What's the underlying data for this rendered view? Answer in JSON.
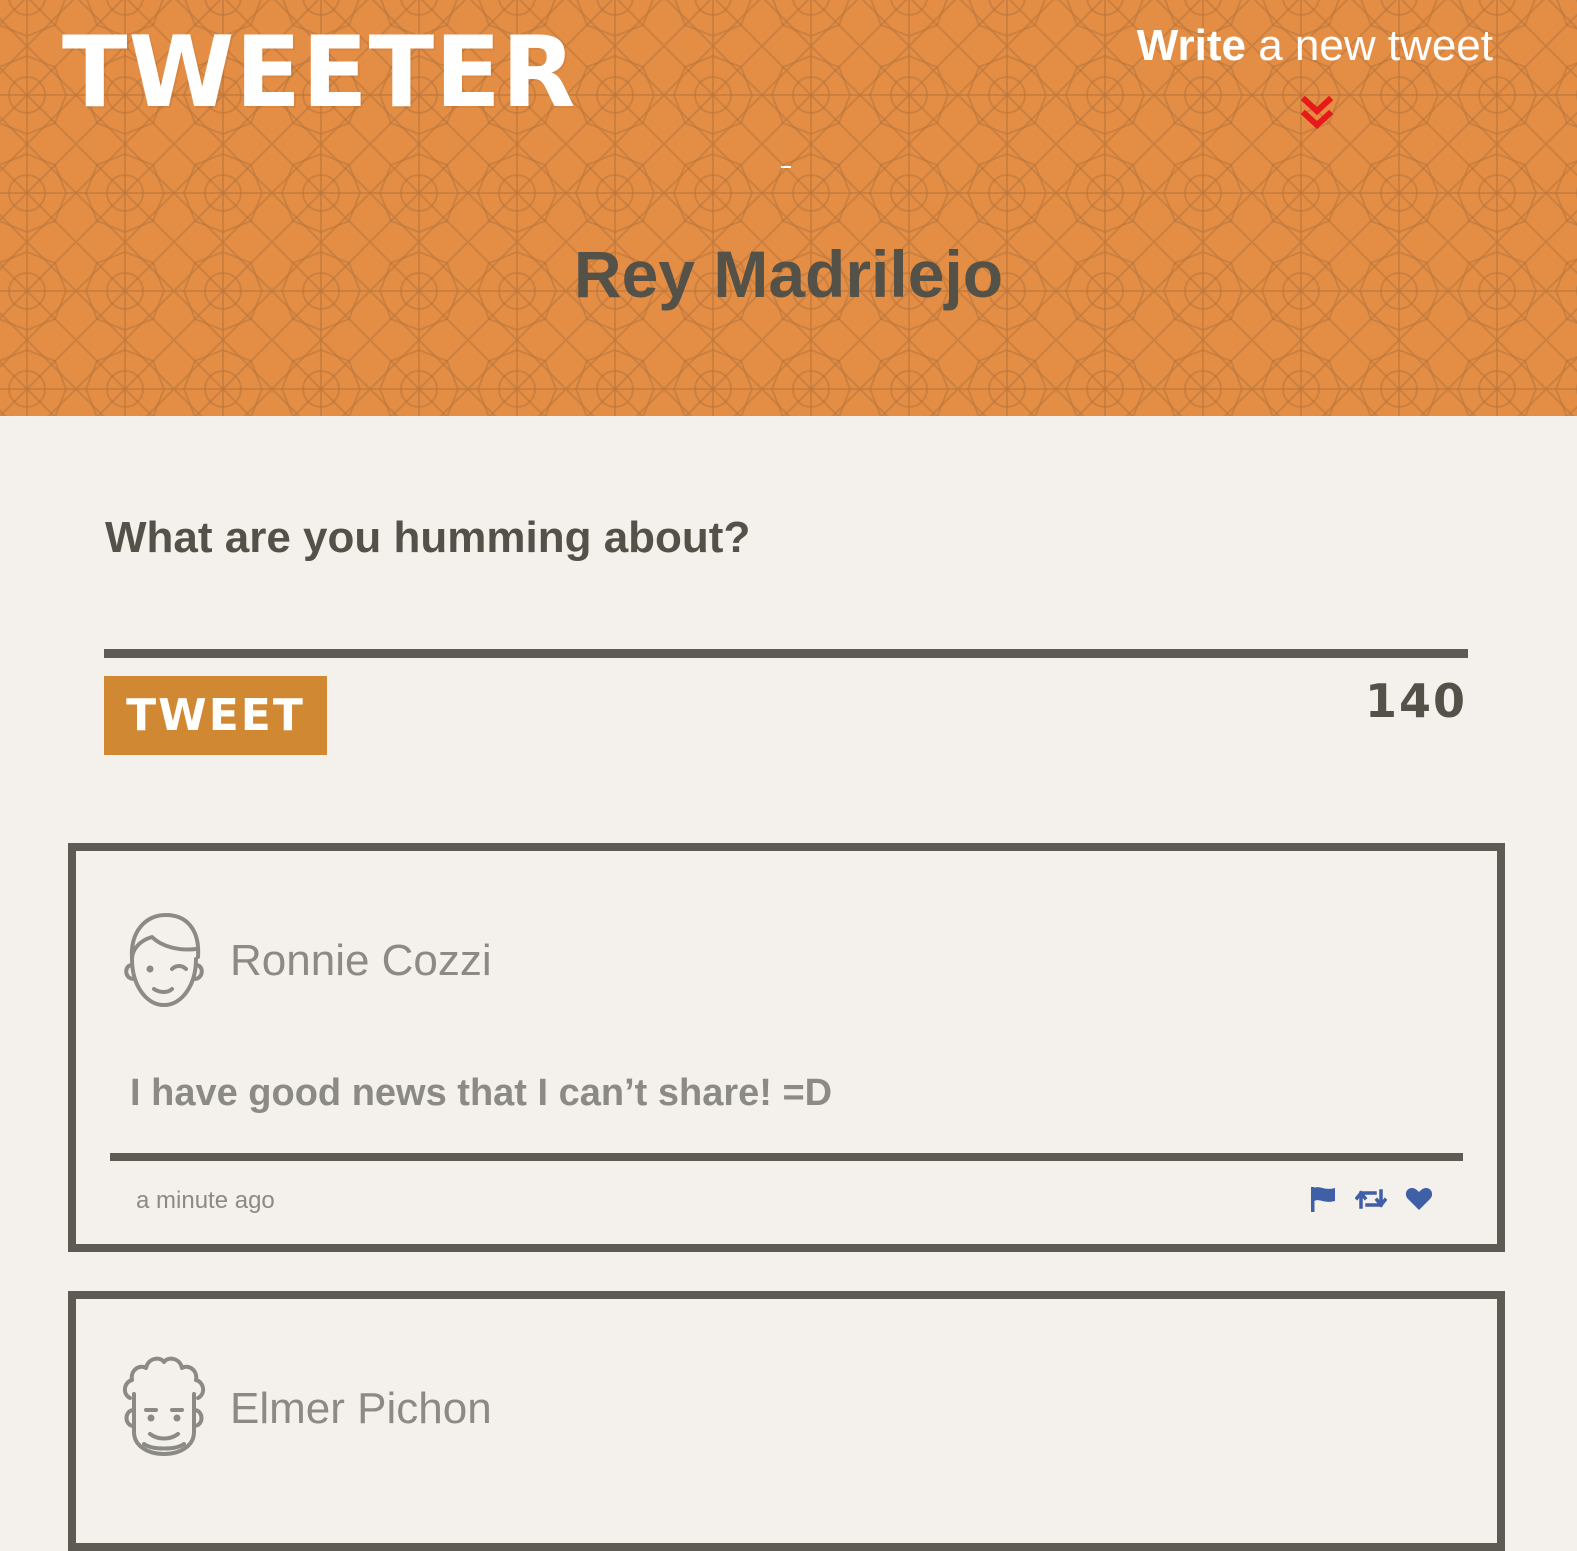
{
  "header": {
    "logo": "TWEETER",
    "compose_link": {
      "strong": "Write",
      "rest": " a new tweet"
    },
    "profile_name": "Rey Madrilejo"
  },
  "compose": {
    "prompt": "What are you humming about?",
    "input_value": "",
    "button_label": "TWEET",
    "char_count": "140"
  },
  "tweets": [
    {
      "author": "Ronnie Cozzi",
      "text": "I have good news that I can’t share! =D",
      "time": "a minute ago"
    },
    {
      "author": "Elmer Pichon"
    }
  ],
  "icons": {
    "chevron": "double-chevron-down-icon",
    "flag": "flag-icon",
    "retweet": "retweet-icon",
    "like": "heart-icon"
  },
  "colors": {
    "header_bg": "#e48e45",
    "page_bg": "#f4f1ec",
    "button_bg": "#d08832",
    "text_dark": "#545149",
    "text_muted": "#8c8a85",
    "border": "#5e5b54",
    "accent_red": "#e8191b",
    "icon_blue": "#3f5fa6"
  }
}
